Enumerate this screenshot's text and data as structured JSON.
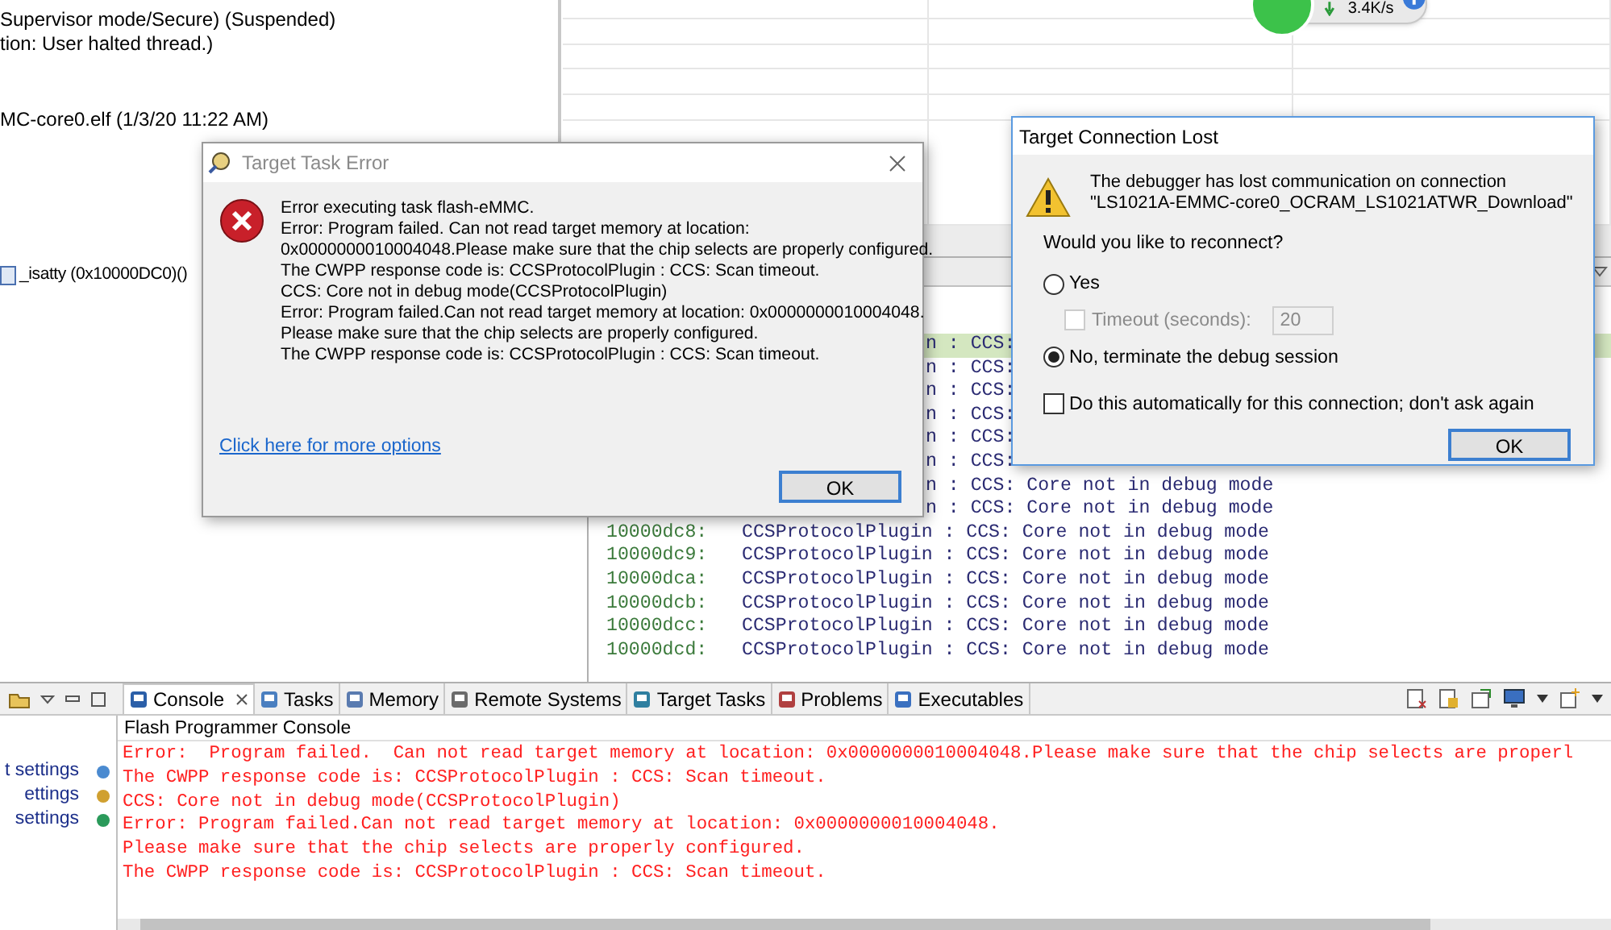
{
  "debug_view": {
    "lines": [
      "Supervisor mode/Secure)  (Suspended)",
      "tion: User halted thread.)",
      "MC-core0.elf (1/3/20 11:22 AM)"
    ]
  },
  "network_monitor": {
    "speed": "3.4K/s"
  },
  "stack_frame": {
    "label": "_isatty (0x10000DC0)()"
  },
  "disassembly": {
    "rows": [
      {
        "text": "n : CCS:",
        "current": true
      },
      {
        "text": "n : CCS:",
        "current": false
      },
      {
        "text": "n : CCS:",
        "current": false
      },
      {
        "text": "n : CCS:",
        "current": false
      },
      {
        "text": "n : CCS:",
        "current": false
      },
      {
        "text": "n : CCS:",
        "current": false
      },
      {
        "text": "n : CCS: Core not in debug mode",
        "current": false
      },
      {
        "text": "n : CCS: Core not in debug mode",
        "current": false
      },
      {
        "address": "10000dc8:",
        "text": "CCSProtocolPlugin : CCS: Core not in debug mode",
        "current": false
      },
      {
        "address": "10000dc9:",
        "text": "CCSProtocolPlugin : CCS: Core not in debug mode",
        "current": false
      },
      {
        "address": "10000dca:",
        "text": "CCSProtocolPlugin : CCS: Core not in debug mode",
        "current": false
      },
      {
        "address": "10000dcb:",
        "text": "CCSProtocolPlugin : CCS: Core not in debug mode",
        "current": false
      },
      {
        "address": "10000dcc:",
        "text": "CCSProtocolPlugin : CCS: Core not in debug mode",
        "current": false
      },
      {
        "address": "10000dcd:",
        "text": "CCSProtocolPlugin : CCS: Core not in debug mode",
        "current": false
      }
    ]
  },
  "side_panel": {
    "items": [
      "t settings",
      "ettings",
      "settings"
    ]
  },
  "console_view": {
    "tabs": [
      {
        "label": "Console",
        "selected": true
      },
      {
        "label": "Tasks",
        "selected": false
      },
      {
        "label": "Memory",
        "selected": false
      },
      {
        "label": "Remote Systems",
        "selected": false
      },
      {
        "label": "Target Tasks",
        "selected": false
      },
      {
        "label": "Problems",
        "selected": false
      },
      {
        "label": "Executables",
        "selected": false
      }
    ],
    "title": "Flash Programmer Console",
    "lines": [
      "Error:  Program failed.  Can not read target memory at location: 0x0000000010004048.Please make sure that the chip selects are properl",
      "The CWPP response code is: CCSProtocolPlugin : CCS: Scan timeout.",
      "CCS: Core not in debug mode(CCSProtocolPlugin)",
      "Error: Program failed.Can not read target memory at location: 0x0000000010004048.",
      "Please make sure that the chip selects are properly configured.",
      "The CWPP response code is: CCSProtocolPlugin : CCS: Scan timeout."
    ]
  },
  "error_dialog": {
    "title": "Target Task Error",
    "message_lines": [
      "Error executing task flash-eMMC.",
      "Error:  Program failed.  Can not read target memory at location:",
      "0x0000000010004048.Please make sure that the chip selects are properly configured.",
      "The CWPP response code is: CCSProtocolPlugin : CCS: Scan timeout.",
      "CCS: Core not in debug mode(CCSProtocolPlugin)",
      "Error: Program failed.Can not read target memory at location: 0x0000000010004048.",
      "Please make sure that the chip selects are properly configured.",
      "The CWPP response code is: CCSProtocolPlugin : CCS: Scan timeout."
    ],
    "link": "Click here for more options",
    "ok": "OK"
  },
  "connection_dialog": {
    "title": "Target Connection Lost",
    "message_lines": [
      "The debugger has lost communication on connection",
      "\"LS1021A-EMMC-core0_OCRAM_LS1021ATWR_Download\""
    ],
    "question": "Would you like to reconnect?",
    "options": [
      {
        "label": "Yes",
        "selected": false
      },
      {
        "label": "No, terminate the debug session",
        "selected": true
      }
    ],
    "timeout": {
      "label": "Timeout (seconds):",
      "value": "20",
      "checked": false,
      "disabled": true
    },
    "auto_checkbox": {
      "label": "Do this automatically for this connection; don't ask again",
      "checked": false
    },
    "ok": "OK"
  }
}
